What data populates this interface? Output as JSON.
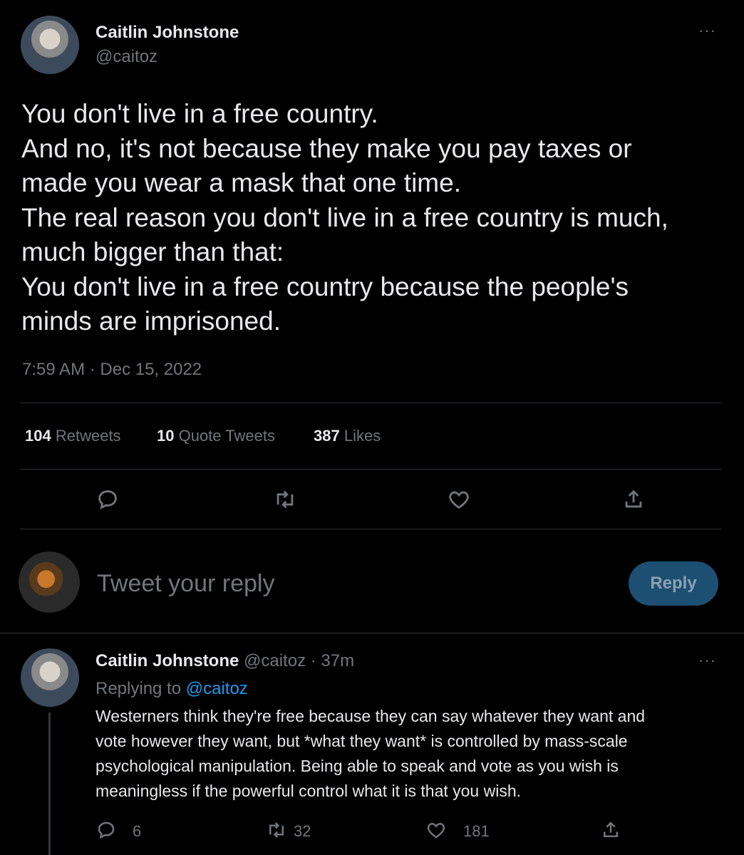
{
  "main_tweet": {
    "author_name": "Caitlin Johnstone",
    "author_handle": "@caitoz",
    "more_label": "···",
    "lines": [
      "You don't live in a free country.",
      "And no, it's not because they make you pay taxes or",
      "made you wear a mask that one time.",
      "The real reason you don't live in a free country is much,",
      "much bigger than that:",
      "You don't live in a free country because the people's",
      "minds are imprisoned."
    ],
    "timestamp": "7:59 AM · Dec 15, 2022",
    "stats": {
      "retweets_count": "104",
      "retweets_label": "Retweets",
      "quotes_count": "10",
      "quotes_label": "Quote Tweets",
      "likes_count": "387",
      "likes_label": "Likes"
    },
    "actions": [
      "reply-icon",
      "retweet-icon",
      "like-icon",
      "share-icon"
    ]
  },
  "composer": {
    "placeholder": "Tweet your reply",
    "button_label": "Reply"
  },
  "reply_tweet": {
    "author_name": "Caitlin Johnstone",
    "author_handle": "@caitoz",
    "time": "· 37m",
    "replying_prefix": "Replying to",
    "replying_handle": "@caitoz",
    "more_label": "···",
    "lines": [
      "Westerners think they're free because they can say whatever they want and",
      "vote however they want, but *what they want* is controlled by mass-scale",
      "psychological manipulation. Being able to speak and vote as you wish is",
      "meaningless if the powerful control what it is that you wish."
    ],
    "counts": {
      "replies": "6",
      "retweets": "32",
      "likes": "181"
    }
  }
}
